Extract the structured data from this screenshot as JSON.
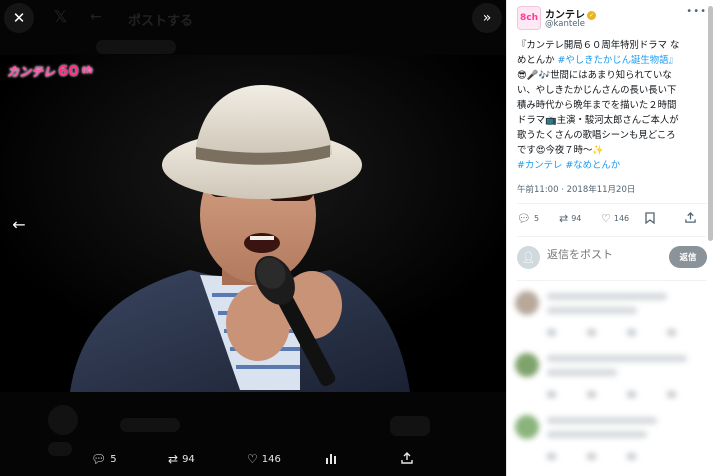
{
  "media": {
    "logo_text": "カンテレ",
    "logo_num": "60",
    "logo_suffix": "th",
    "ghost_header": "ポストする",
    "close_icon": "close-icon",
    "expand_icon": "double-chevron-right-icon",
    "prev_icon": "arrow-left-icon"
  },
  "bottom_actions": [
    {
      "name": "reply",
      "icon": "comment-icon",
      "count": "5"
    },
    {
      "name": "repost",
      "icon": "repost-icon",
      "count": "94"
    },
    {
      "name": "like",
      "icon": "heart-icon",
      "count": "146"
    },
    {
      "name": "views",
      "icon": "bar-chart-icon",
      "count": ""
    },
    {
      "name": "share",
      "icon": "share-icon",
      "count": ""
    }
  ],
  "author": {
    "name": "カンテレ",
    "handle": "@kantele",
    "avatar_text": "8ch"
  },
  "tweet": {
    "lines": [
      "『カンテレ開局６０周年特別ドラマ な",
      "めとんか",
      "😎🎤🎶世間にはあまり知られていな",
      "い、やしきたかじんさんの長い長い下",
      "積み時代から晩年までを描いた２時間",
      "ドラマ📺主演・駿河太郎さんご本人が",
      "歌うたくさんの歌唱シーンも見どころ",
      "です😍今夜７時〜✨"
    ],
    "hashtag_inline": " #やしきたかじん誕生物語』",
    "hashtags": "#カンテレ #なめとんか",
    "timestamp": "午前11:00 · 2018年11月20日"
  },
  "side_actions": [
    {
      "name": "reply",
      "icon": "comment-icon",
      "count": "5"
    },
    {
      "name": "repost",
      "icon": "repost-icon",
      "count": "94"
    },
    {
      "name": "like",
      "icon": "heart-icon",
      "count": "146"
    },
    {
      "name": "bookmark",
      "icon": "bookmark-icon",
      "count": ""
    },
    {
      "name": "share",
      "icon": "share-icon",
      "count": ""
    }
  ],
  "reply": {
    "placeholder": "返信をポスト",
    "button_label": "返信"
  },
  "colors": {
    "link": "#1d9bf0",
    "brand_pink": "#ff3a97"
  }
}
